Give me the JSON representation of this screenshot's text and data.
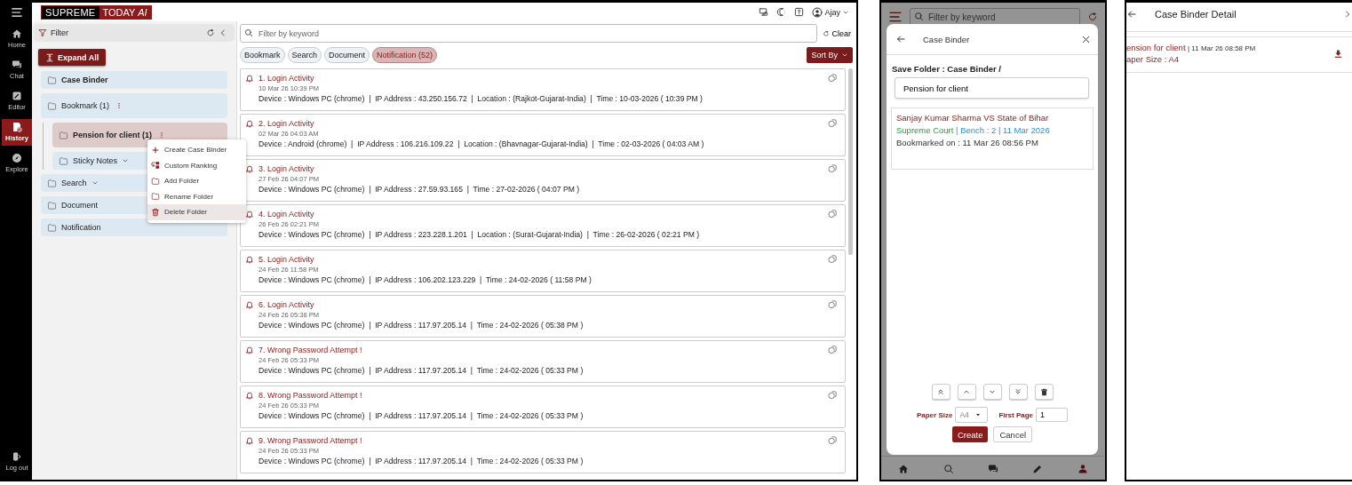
{
  "main": {
    "logo": {
      "left": "SUPREME",
      "right": "TODAY *AI*"
    },
    "user": {
      "name": "Ajay"
    },
    "nav": [
      {
        "label": "Home",
        "kind": "home",
        "selected": false
      },
      {
        "label": "Chat",
        "kind": "chat",
        "selected": false
      },
      {
        "label": "Editor",
        "kind": "editor",
        "selected": false
      },
      {
        "label": "History",
        "kind": "history",
        "selected": true
      },
      {
        "label": "Explore",
        "kind": "explore",
        "selected": false
      }
    ],
    "logout": "Log out",
    "filter_panel": {
      "title": "Filter",
      "expand_button": "Expand All",
      "tree": [
        {
          "label": "Case Binder",
          "bold": true,
          "selected": false,
          "menu": false,
          "collapsible": false
        },
        {
          "label": "Bookmark (1)",
          "bold": false,
          "selected": false,
          "menu": true,
          "collapsible": false,
          "children": [
            {
              "label": "Pension for client (1)",
              "bold": true,
              "selected": true,
              "menu": true,
              "collapsible": false
            },
            {
              "label": "Sticky Notes",
              "bold": false,
              "selected": false,
              "menu": false,
              "collapsible": true
            }
          ]
        },
        {
          "label": "Search",
          "bold": false,
          "selected": false,
          "menu": false,
          "collapsible": true
        },
        {
          "label": "Document",
          "bold": false,
          "selected": false,
          "menu": false,
          "collapsible": false
        },
        {
          "label": "Notification",
          "bold": false,
          "selected": false,
          "menu": false,
          "collapsible": false
        }
      ]
    },
    "context_menu": [
      {
        "label": "Create Case Binder",
        "kind": "plus",
        "highlighted": false
      },
      {
        "label": "Custom Ranking",
        "kind": "ranking",
        "highlighted": false
      },
      {
        "label": "Add Folder",
        "kind": "folder",
        "highlighted": false
      },
      {
        "label": "Rename Folder",
        "kind": "folder",
        "highlighted": false
      },
      {
        "label": "Delete Folder",
        "kind": "trash",
        "highlighted": true
      }
    ],
    "search": {
      "placeholder": "Filter by keyword",
      "clear_button": "Clear"
    },
    "chips": [
      {
        "label": "Bookmark",
        "selected": false
      },
      {
        "label": "Search",
        "selected": false
      },
      {
        "label": "Document",
        "selected": false
      },
      {
        "label": "Notification (52)",
        "selected": true
      }
    ],
    "sort_button": "Sort By",
    "notifications": [
      {
        "title": "1. Login Activity",
        "date": "10 Mar 26 10:39 PM",
        "details": "Device : Windows PC (chrome)  |  IP Address : 43.250.156.72  |  Location : (Rajkot-Gujarat-India)  |  Time : 10-03-2026 ( 10:39 PM )"
      },
      {
        "title": "2. Login Activity",
        "date": "02 Mar 26 04:03 AM",
        "details": "Device : Android (chrome)  |  IP Address : 106.216.109.22  |  Location : (Bhavnagar-Gujarat-India)  |  Time : 02-03-2026 ( 04:03 AM )"
      },
      {
        "title": "3. Login Activity",
        "date": "27 Feb 26 04:07 PM",
        "details": "Device : Windows PC (chrome)  |  IP Address : 27.59.93.165  |  Time : 27-02-2026 ( 04:07 PM )"
      },
      {
        "title": "4. Login Activity",
        "date": "26 Feb 26 02:21 PM",
        "details": "Device : Windows PC (chrome)  |  IP Address : 223.228.1.201  |  Location : (Surat-Gujarat-India)  |  Time : 26-02-2026 ( 02:21 PM )"
      },
      {
        "title": "5. Login Activity",
        "date": "24 Feb 26 11:58 PM",
        "details": "Device : Windows PC (chrome)  |  IP Address : 106.202.123.229  |  Time : 24-02-2026 ( 11:58 PM )"
      },
      {
        "title": "6. Login Activity",
        "date": "24 Feb 26 05:38 PM",
        "details": "Device : Windows PC (chrome)  |  IP Address : 117.97.205.14  |  Time : 24-02-2026 ( 05:38 PM )"
      },
      {
        "title": "7. Wrong Password Attempt !",
        "date": "24 Feb 26 05:33 PM",
        "details": "Device : Windows PC (chrome)  |  IP Address : 117.97.205.14  |  Time : 24-02-2026 ( 05:33 PM )"
      },
      {
        "title": "8. Wrong Password Attempt !",
        "date": "24 Feb 26 05:33 PM",
        "details": "Device : Windows PC (chrome)  |  IP Address : 117.97.205.14  |  Time : 24-02-2026 ( 05:33 PM )"
      },
      {
        "title": "9. Wrong Password Attempt !",
        "date": "24 Feb 26 05:33 PM",
        "details": "Device : Windows PC (chrome)  |  IP Address : 117.97.205.14  |  Time : 24-02-2026 ( 05:33 PM )"
      }
    ]
  },
  "dialog": {
    "background_search": {
      "placeholder": "Filter by keyword"
    },
    "title": "Case Binder",
    "save_folder": "Save Folder : Case Binder /",
    "folder_name": "Pension for client",
    "bookmark": {
      "title": "Sanjay Kumar Sharma VS State of Bihar",
      "court": "Supreme Court",
      "meta": "| Bench : 2 | 11 Mar 2026",
      "bookmarked_on": "Bookmarked on : 11 Mar 26 08:56 PM"
    },
    "paper_size_label": "Paper Size",
    "paper_size": "A4",
    "first_page_label": "First Page",
    "first_page": "1",
    "create_button": "Create",
    "cancel_button": "Cancel",
    "bottom_nav": [
      {
        "kind": "home",
        "selected": false
      },
      {
        "kind": "search",
        "selected": false
      },
      {
        "kind": "chat",
        "selected": false
      },
      {
        "kind": "pen",
        "selected": false
      },
      {
        "kind": "profile",
        "selected": true
      }
    ]
  },
  "detail": {
    "title": "Case Binder Detail",
    "items": [
      {
        "name": "ension for client",
        "date": "| 11 Mar 26 08:58 PM",
        "paper": "aper Size :  A4"
      }
    ]
  }
}
